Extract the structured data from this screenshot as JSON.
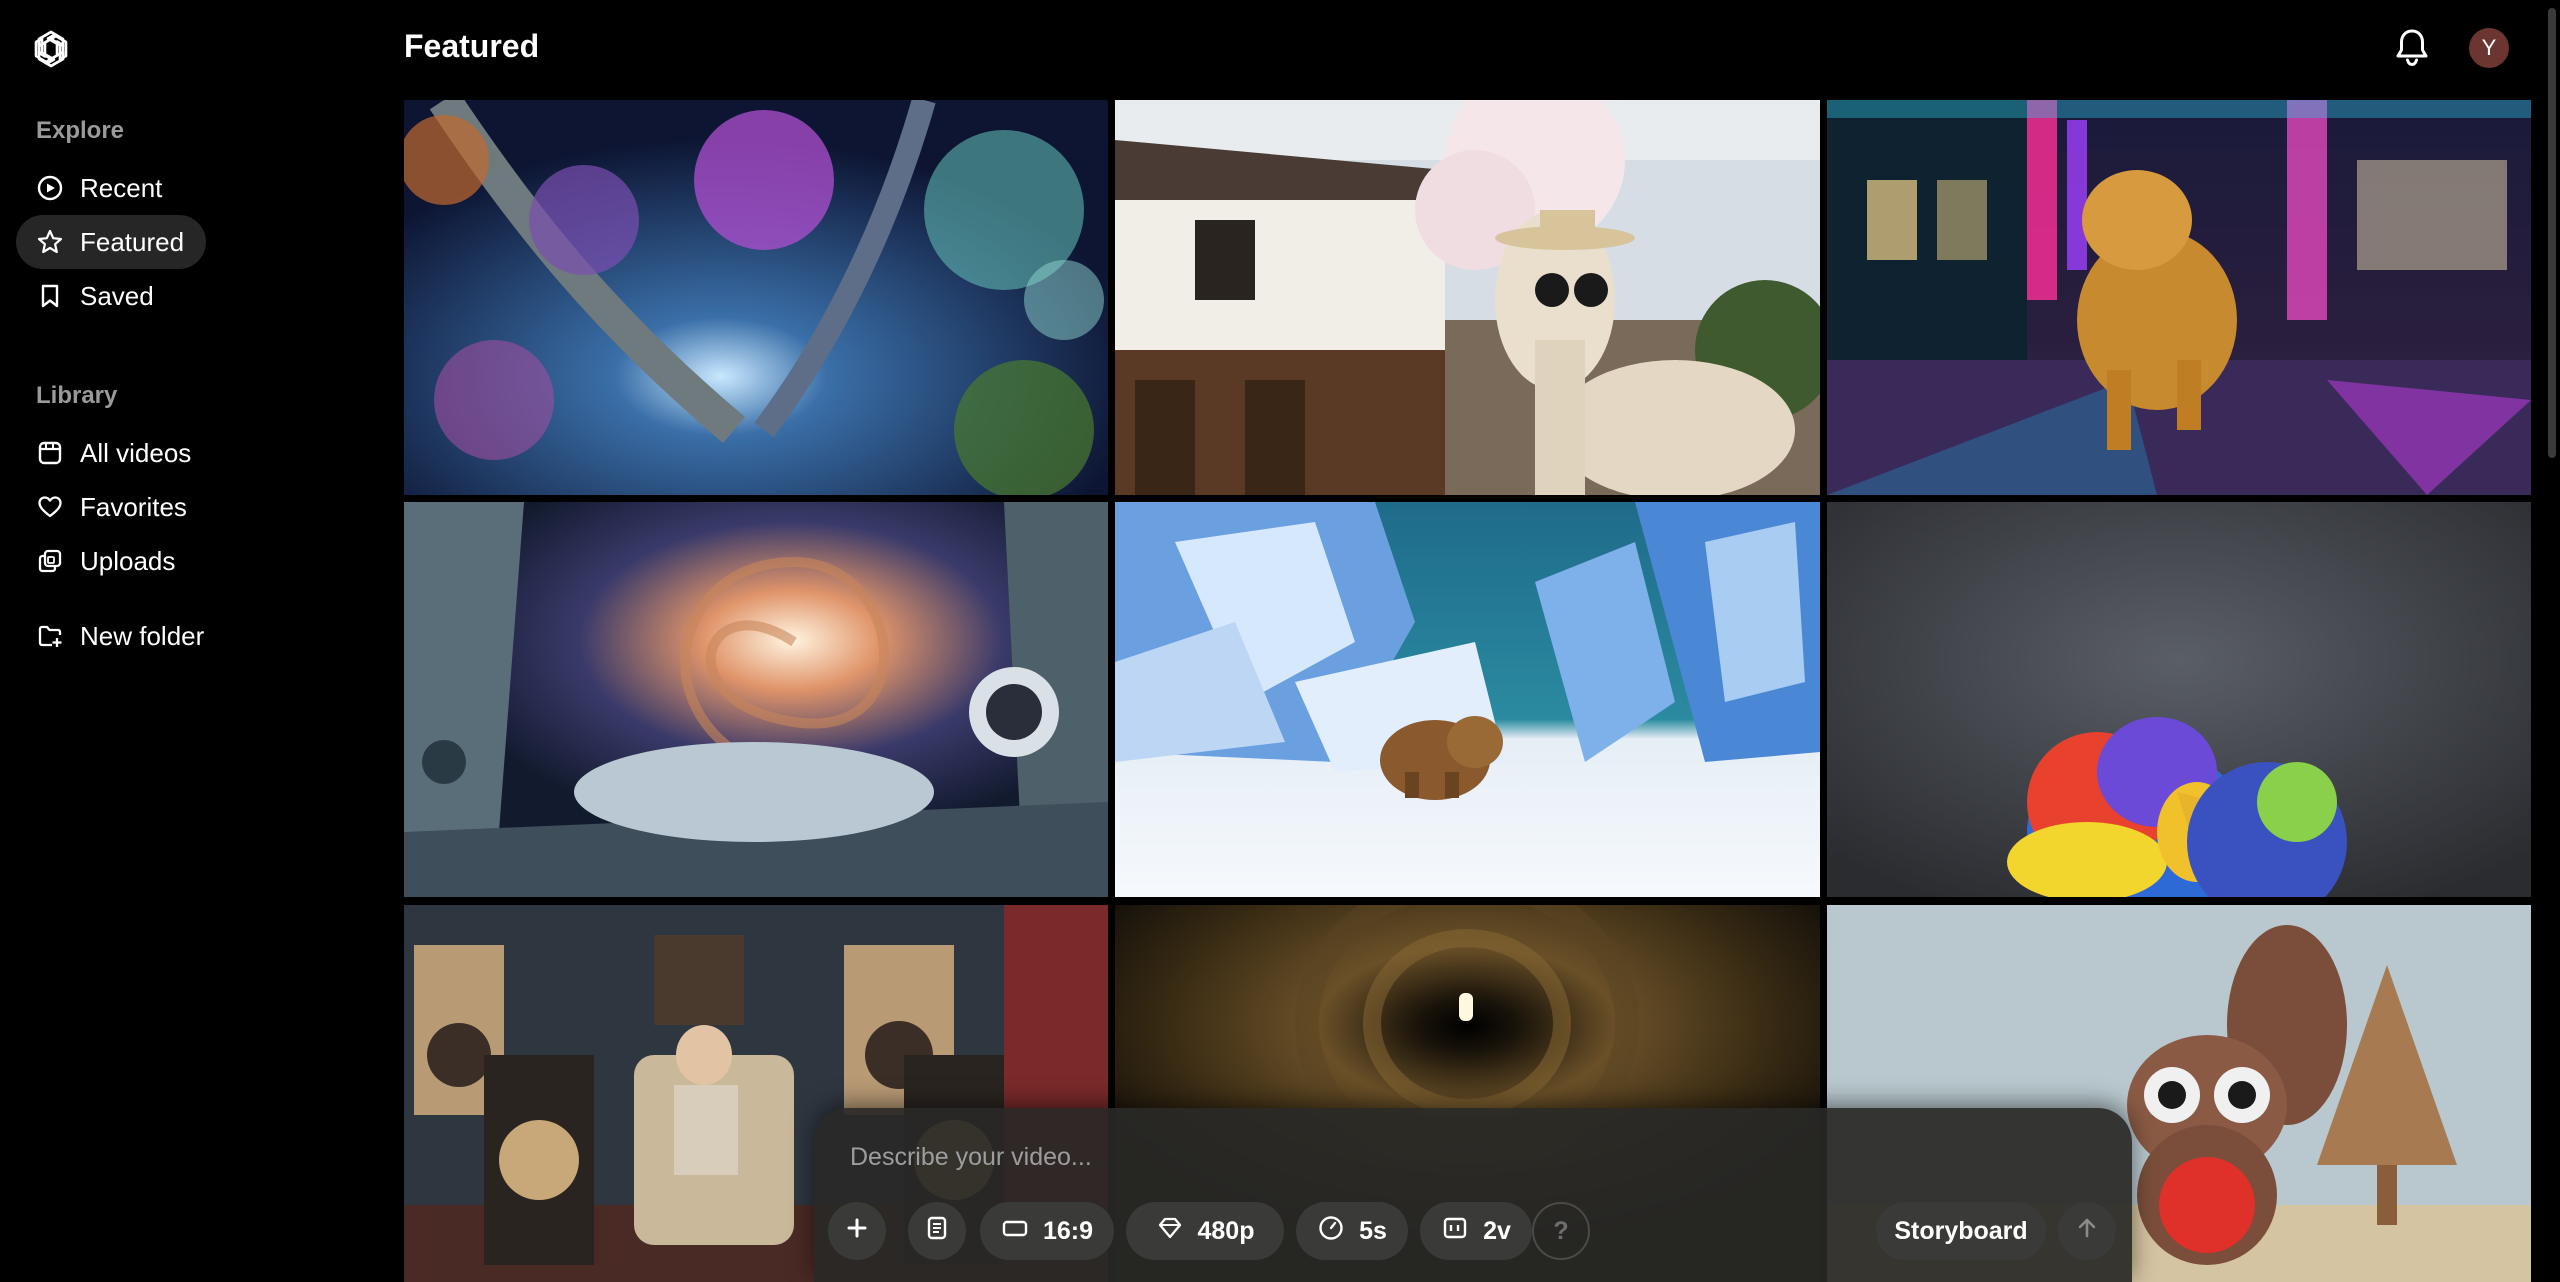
{
  "page": {
    "title": "Featured"
  },
  "user": {
    "avatar_initial": "Y"
  },
  "sidebar": {
    "explore_label": "Explore",
    "explore_items": [
      {
        "label": "Recent",
        "icon": "play-circle-icon"
      },
      {
        "label": "Featured",
        "icon": "star-icon",
        "active": true
      },
      {
        "label": "Saved",
        "icon": "bookmark-icon"
      }
    ],
    "library_label": "Library",
    "library_items": [
      {
        "label": "All videos",
        "icon": "video-grid-icon"
      },
      {
        "label": "Favorites",
        "icon": "heart-icon"
      },
      {
        "label": "Uploads",
        "icon": "uploads-icon"
      }
    ],
    "new_folder_label": "New folder"
  },
  "grid": {
    "tiles": [
      {
        "subject": "glowing fantasy forest"
      },
      {
        "subject": "camel with sunglasses by japanese house"
      },
      {
        "subject": "golden retriever in neon city"
      },
      {
        "subject": "astronaut and spiral galaxy"
      },
      {
        "subject": "woolly mammoth in ice landscape"
      },
      {
        "subject": "colorful parrot"
      },
      {
        "subject": "old man with speakers"
      },
      {
        "subject": "cave tunnel with light"
      },
      {
        "subject": "paper squirrel craft"
      }
    ]
  },
  "composer": {
    "placeholder": "Describe your video...",
    "aspect_ratio": "16:9",
    "resolution": "480p",
    "duration": "5s",
    "variations": "2v",
    "help": "?",
    "storyboard": "Storyboard"
  },
  "colors": {
    "background": "#000000",
    "active_nav": "#262626",
    "composer_bg": "#282826"
  }
}
